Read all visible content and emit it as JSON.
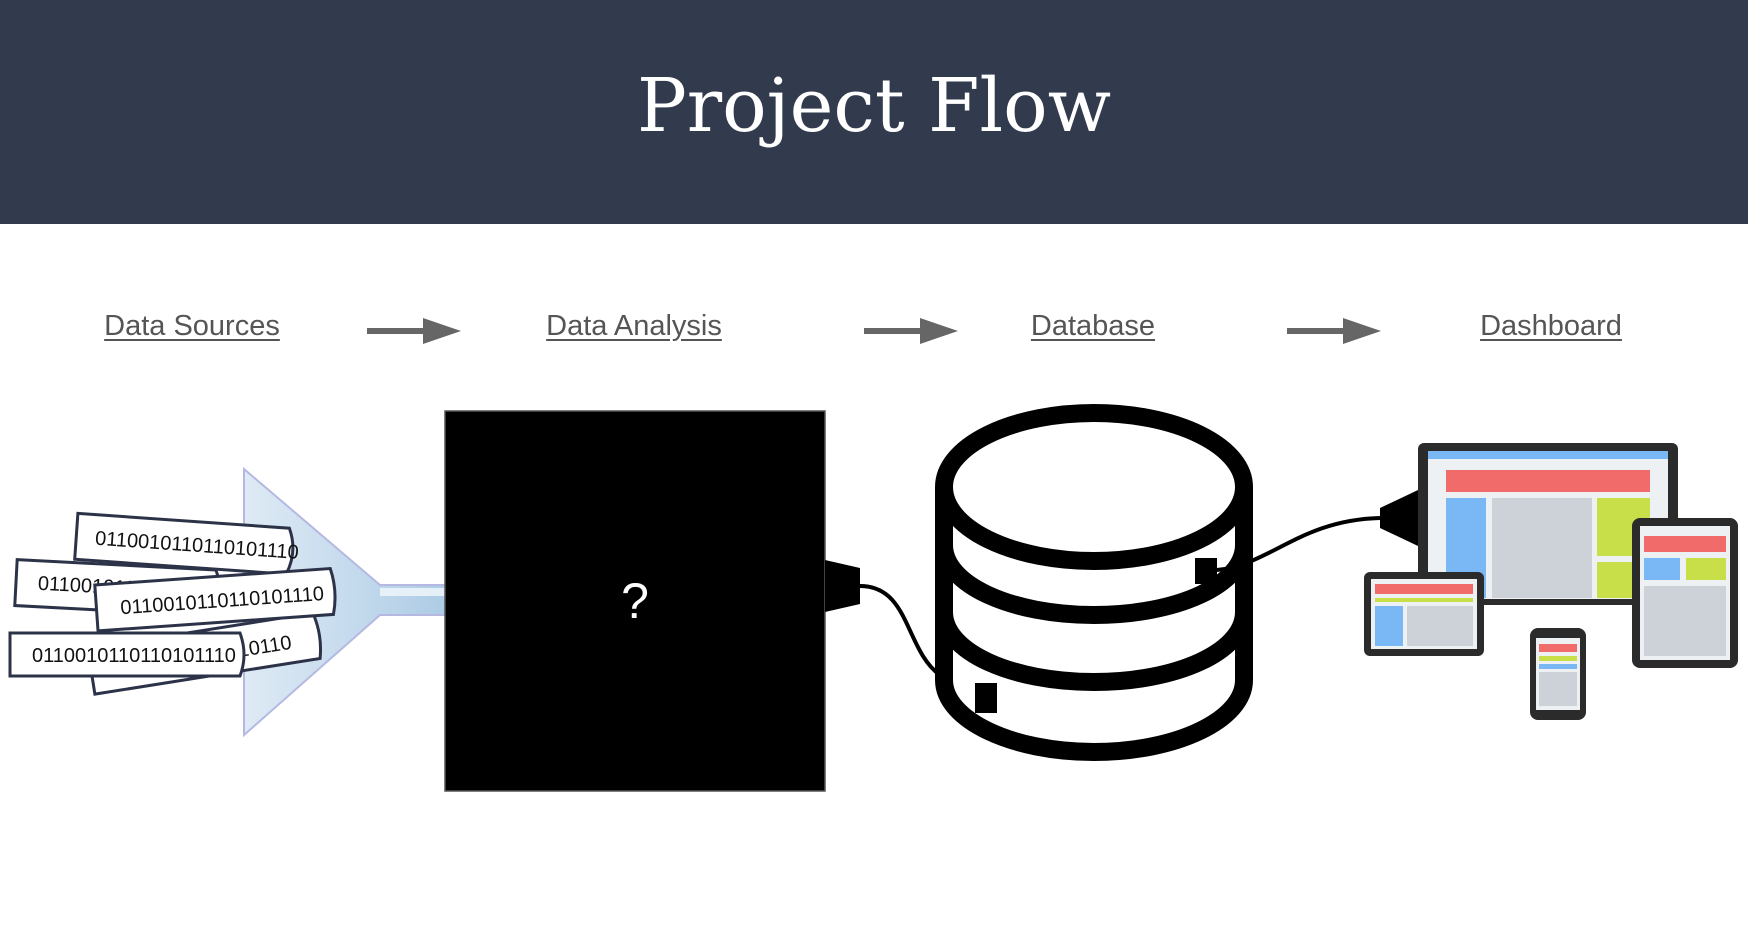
{
  "header": {
    "title": "Project Flow",
    "background": "#323a4e"
  },
  "steps": [
    {
      "label": "Data Sources"
    },
    {
      "label": "Data Analysis"
    },
    {
      "label": "Database"
    },
    {
      "label": "Dashboard"
    }
  ],
  "data_sources": {
    "binary_strips": [
      "0110010110110101110",
      "0110010110110101110",
      "0110010110110101110",
      "0110010110110101110",
      "10110"
    ]
  },
  "analysis": {
    "label": "?"
  },
  "colors": {
    "accent_red": "#f26b6b",
    "accent_blue": "#7ab8f5",
    "accent_green": "#c9df4a",
    "funnel": "#a9c9e4"
  },
  "icons": [
    "funnel-icon",
    "black-box-icon",
    "database-icon",
    "responsive-devices-icon",
    "arrow-right-icon"
  ]
}
